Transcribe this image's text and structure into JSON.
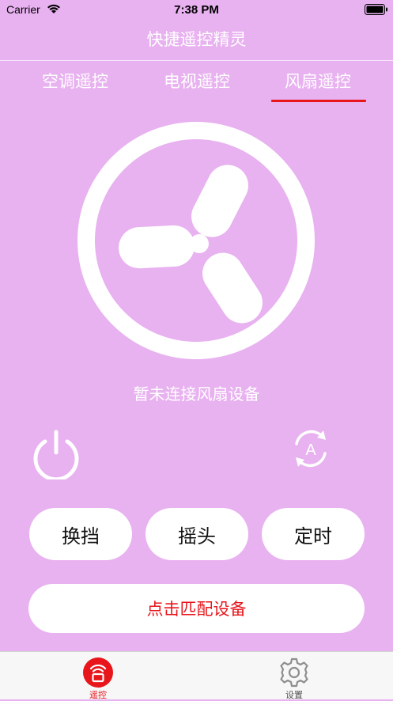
{
  "status_bar": {
    "carrier": "Carrier",
    "time": "7:38 PM"
  },
  "header": {
    "title": "快捷遥控精灵"
  },
  "tabs": [
    {
      "label": "空调遥控",
      "selected": false
    },
    {
      "label": "电视遥控",
      "selected": false
    },
    {
      "label": "风扇遥控",
      "selected": true
    }
  ],
  "fan": {
    "status_text": "暂未连接风扇设备"
  },
  "controls": {
    "power_icon": "power-icon",
    "auto_icon": "auto-rotate-icon",
    "auto_letter": "A"
  },
  "buttons": {
    "speed": "换挡",
    "swing": "摇头",
    "timer": "定时",
    "pair": "点击匹配设备"
  },
  "tabbar": {
    "items": [
      {
        "label": "遥控",
        "icon": "remote-icon",
        "active": true
      },
      {
        "label": "设置",
        "icon": "gear-icon",
        "active": false
      }
    ]
  },
  "colors": {
    "background": "#e8b1f0",
    "accent": "#e8151b",
    "white": "#ffffff"
  }
}
